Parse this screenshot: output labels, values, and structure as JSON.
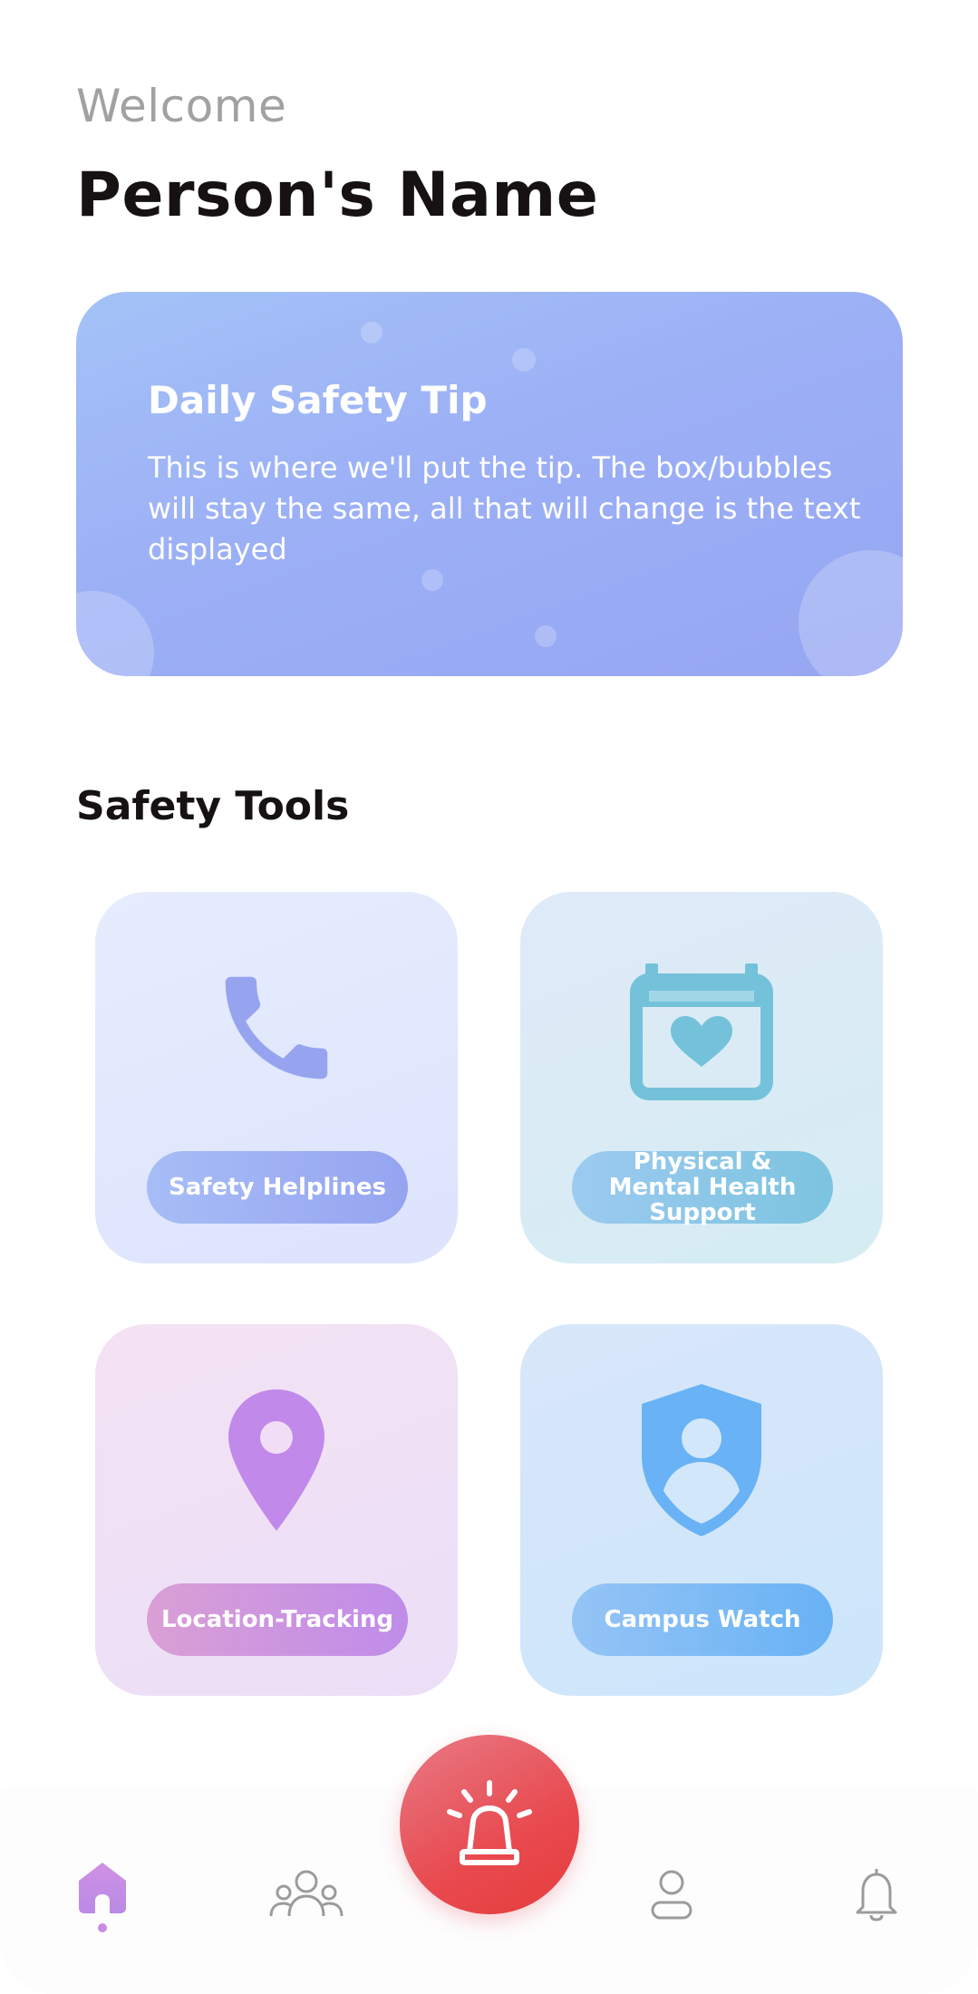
{
  "greeting": {
    "welcome": "Welcome",
    "name": "Person's Name"
  },
  "tip": {
    "title": "Daily Safety Tip",
    "text": "This is where we'll put the tip. The box/bubbles will stay the same, all that will change is the text displayed"
  },
  "tools": {
    "section_title": "Safety Tools",
    "items": [
      {
        "label": "Safety Helplines",
        "icon": "phone-icon",
        "color": "#96a4f0"
      },
      {
        "label": "Physical & Mental Health Support",
        "icon": "calendar-heart-icon",
        "color": "#74c2da"
      },
      {
        "label": "Location-Tracking",
        "icon": "location-pin-icon",
        "color": "#c189ea"
      },
      {
        "label": "Campus Watch",
        "icon": "shield-user-icon",
        "color": "#68b2f5"
      }
    ]
  },
  "nav": {
    "items": [
      {
        "name": "home",
        "icon": "home-icon",
        "active": true
      },
      {
        "name": "community",
        "icon": "group-icon",
        "active": false
      },
      {
        "name": "alarm",
        "icon": "siren-icon",
        "active": false
      },
      {
        "name": "profile",
        "icon": "user-icon",
        "active": false
      },
      {
        "name": "notifications",
        "icon": "bell-icon",
        "active": false
      }
    ],
    "accent_color": "#c88ce0",
    "alarm_color": "#e84a4f"
  }
}
